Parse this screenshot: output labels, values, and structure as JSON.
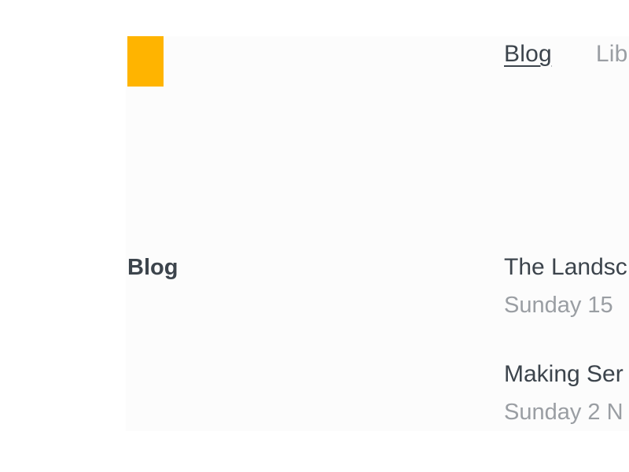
{
  "brand": {
    "logo_color": "#ffb400"
  },
  "nav": {
    "items": [
      {
        "label": "Blog",
        "active": true
      },
      {
        "label": "Lib",
        "active": false
      }
    ]
  },
  "section": {
    "title": "Blog"
  },
  "posts": [
    {
      "title": "The Landsc",
      "date": "Sunday 15"
    },
    {
      "title": "Making Ser",
      "date": "Sunday 2 N"
    }
  ],
  "colors": {
    "text_dark": "#3c444c",
    "text_muted": "#9a9ea3",
    "panel_bg": "#fcfcfc"
  }
}
